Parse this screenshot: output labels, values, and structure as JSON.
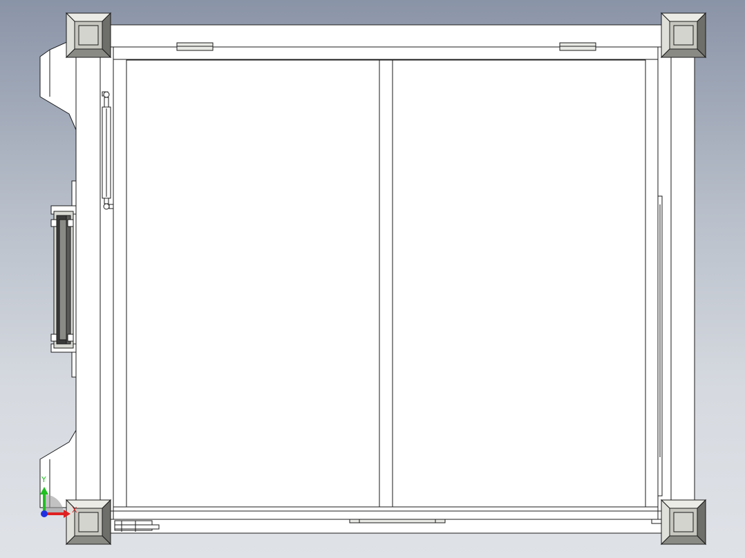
{
  "view": {
    "background_top": "#8a94a7",
    "background_bottom": "#dfe2e7"
  },
  "model": {
    "line_color": "#1a1a1a",
    "face_color": "#ffffff",
    "shaded_part_color": "#d9d9d4",
    "dark_part_color": "#3a3a3a"
  },
  "triad": {
    "x_label": "X",
    "y_label": "Y",
    "x_color": "#e02020",
    "y_color": "#20c020",
    "z_color": "#2030e0"
  }
}
